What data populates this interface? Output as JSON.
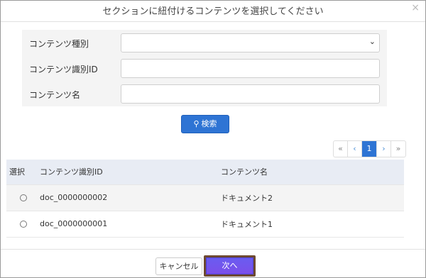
{
  "dialog": {
    "title": "セクションに紐付けるコンテンツを選択してください",
    "close_glyph": "×"
  },
  "form": {
    "type_label": "コンテンツ種別",
    "type_value": "",
    "id_label": "コンテンツ識別ID",
    "id_value": "",
    "name_label": "コンテンツ名",
    "name_value": ""
  },
  "search": {
    "label": "検索",
    "icon": "search-icon"
  },
  "pagination": {
    "first": "«",
    "prev": "‹",
    "current": "1",
    "next": "›",
    "last": "»"
  },
  "table": {
    "headers": [
      "選択",
      "コンテンツ識別ID",
      "コンテンツ名"
    ],
    "rows": [
      {
        "id": "doc_0000000002",
        "name": "ドキュメント2"
      },
      {
        "id": "doc_0000000001",
        "name": "ドキュメント1"
      }
    ]
  },
  "footer": {
    "cancel_label": "キャンセル",
    "next_label": "次へ"
  },
  "colors": {
    "primary": "#2e74d4",
    "next_button": "#7b4fea",
    "next_border": "#6e4a32",
    "table_header": "#e8ecf4"
  }
}
